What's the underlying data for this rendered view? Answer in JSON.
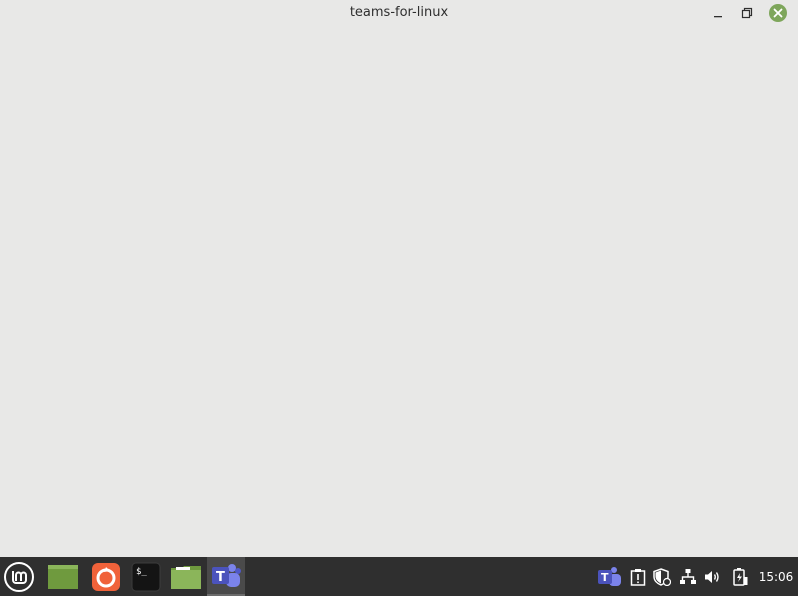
{
  "window": {
    "title": "teams-for-linux",
    "controls": {
      "minimize": "minimize-icon",
      "maximize": "restore-icon",
      "close": "close-icon"
    },
    "colors": {
      "background": "#e8e8e7",
      "close_button": "#7ea65b"
    }
  },
  "taskbar": {
    "colors": {
      "background": "#2f2f2f",
      "active_item": "#4a4a4a"
    },
    "launchers": [
      {
        "name": "menu",
        "icon": "mint-logo-icon"
      },
      {
        "name": "show-desktop",
        "icon": "desktop-icon"
      },
      {
        "name": "firefox",
        "icon": "firefox-icon"
      },
      {
        "name": "terminal",
        "icon": "terminal-icon",
        "glyph": "$_"
      },
      {
        "name": "files",
        "icon": "folder-icon"
      },
      {
        "name": "teams",
        "icon": "teams-icon",
        "glyph": "T",
        "active": true
      }
    ],
    "tray": [
      {
        "name": "teams-tray",
        "icon": "teams-tray-icon",
        "glyph": "T"
      },
      {
        "name": "notes",
        "icon": "clipboard-icon"
      },
      {
        "name": "update-manager",
        "icon": "shield-icon"
      },
      {
        "name": "network",
        "icon": "network-icon"
      },
      {
        "name": "volume",
        "icon": "volume-icon"
      },
      {
        "name": "battery",
        "icon": "battery-icon"
      }
    ],
    "clock": "15:06"
  }
}
